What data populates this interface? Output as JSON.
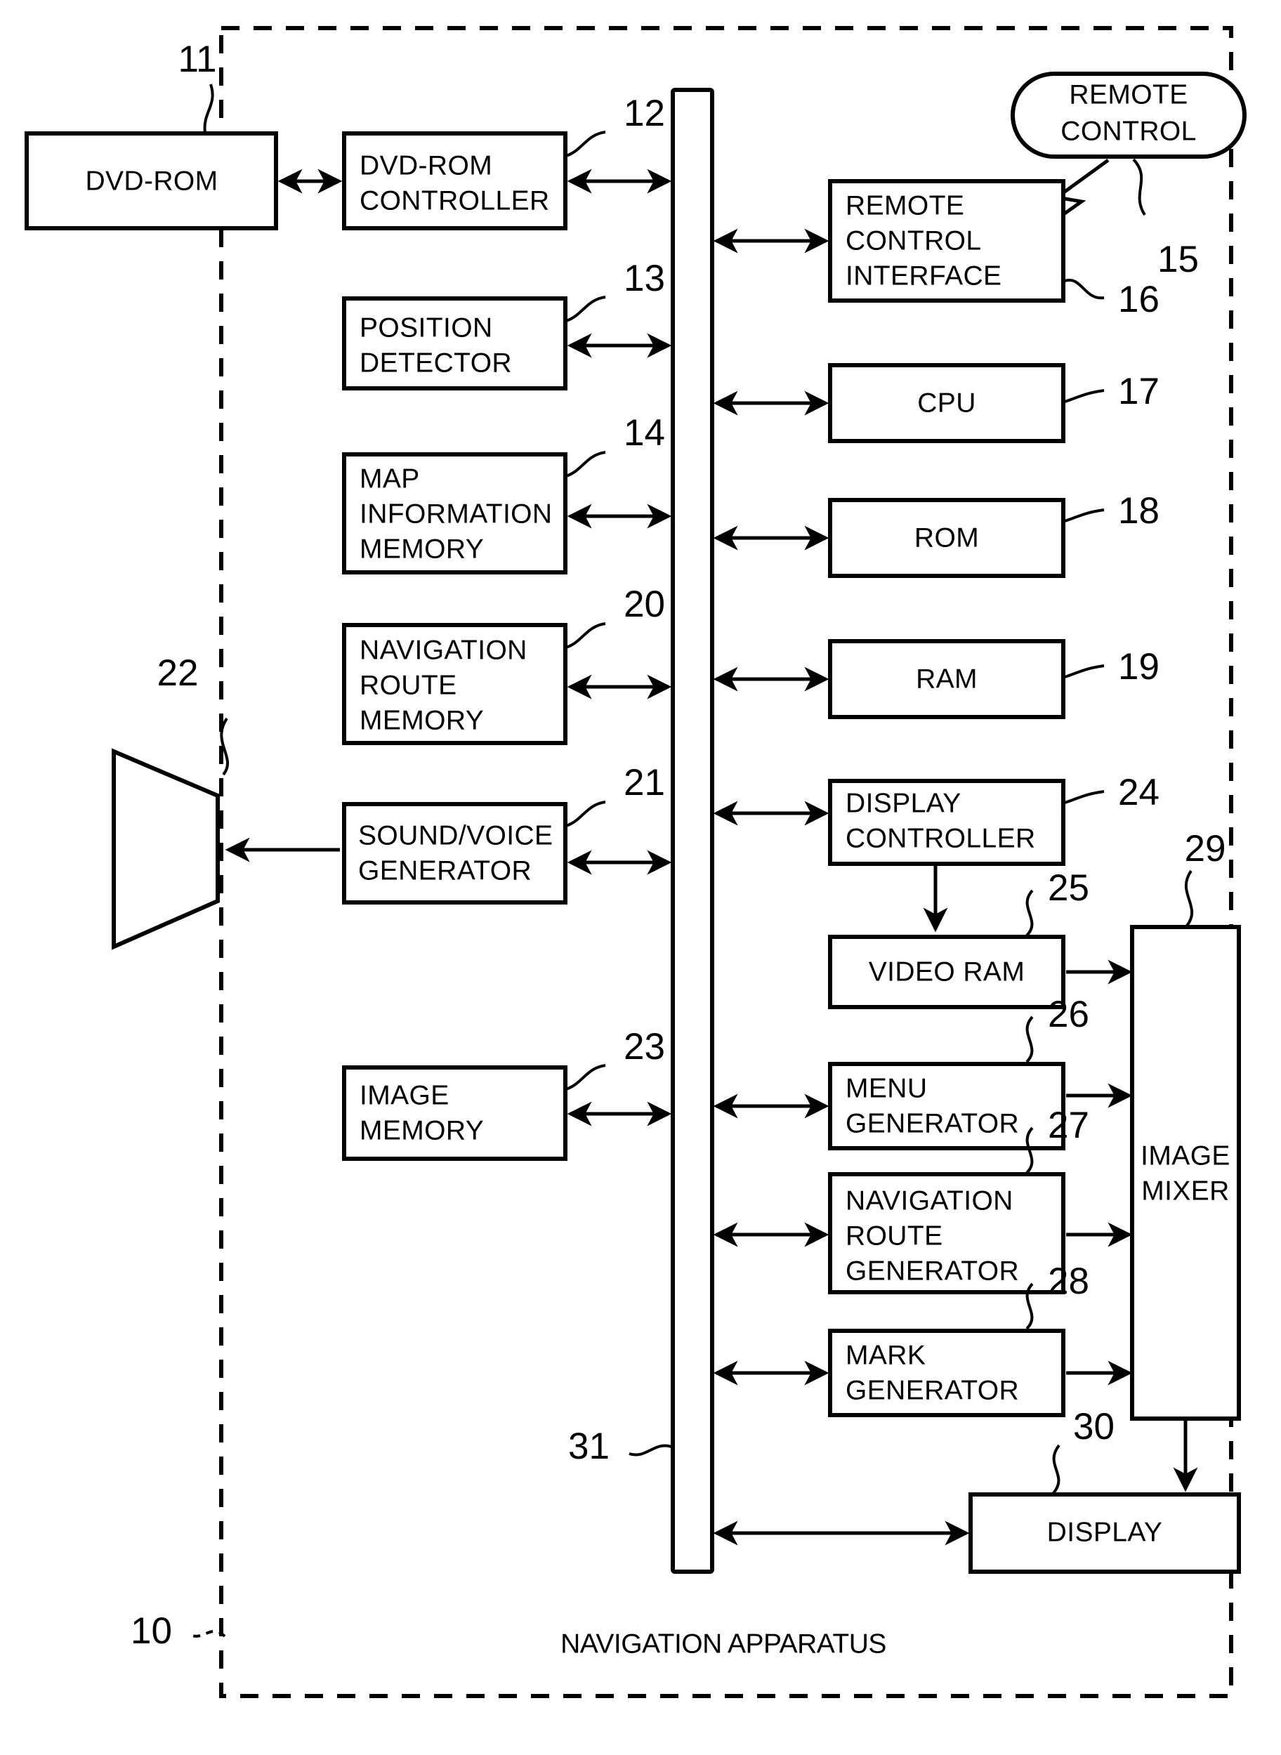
{
  "figure": {
    "title": "NAVIGATION APPARATUS",
    "outer_ref": "10"
  },
  "blocks": {
    "dvd_rom": {
      "label": "DVD-ROM",
      "ref": "11"
    },
    "dvd_rom_controller": {
      "line1": "DVD-ROM",
      "line2": "CONTROLLER",
      "ref": "12"
    },
    "position_detector": {
      "line1": "POSITION",
      "line2": "DETECTOR",
      "ref": "13"
    },
    "map_information_memory": {
      "line1": "MAP",
      "line2": "INFORMATION",
      "line3": "MEMORY",
      "ref": "14"
    },
    "navigation_route_memory": {
      "line1": "NAVIGATION",
      "line2": "ROUTE",
      "line3": "MEMORY",
      "ref": "20"
    },
    "sound_voice_generator": {
      "line1": "SOUND/VOICE",
      "line2": "GENERATOR",
      "ref": "21"
    },
    "speaker": {
      "ref": "22"
    },
    "image_memory": {
      "line1": "IMAGE",
      "line2": "MEMORY",
      "ref": "23"
    },
    "remote_control": {
      "line1": "REMOTE",
      "line2": "CONTROL",
      "ref": "15"
    },
    "remote_control_interface": {
      "line1": "REMOTE",
      "line2": "CONTROL",
      "line3": "INTERFACE",
      "ref": "16"
    },
    "cpu": {
      "label": "CPU",
      "ref": "17"
    },
    "rom": {
      "label": "ROM",
      "ref": "18"
    },
    "ram": {
      "label": "RAM",
      "ref": "19"
    },
    "display_controller": {
      "line1": "DISPLAY",
      "line2": "CONTROLLER",
      "ref": "24"
    },
    "video_ram": {
      "label": "VIDEO RAM",
      "ref": "25"
    },
    "menu_generator": {
      "line1": "MENU",
      "line2": "GENERATOR",
      "ref": "26"
    },
    "navigation_route_generator": {
      "line1": "NAVIGATION",
      "line2": "ROUTE",
      "line3": "GENERATOR",
      "ref": "27"
    },
    "mark_generator": {
      "line1": "MARK",
      "line2": "GENERATOR",
      "ref": "28"
    },
    "image_mixer": {
      "line1": "IMAGE",
      "line2": "MIXER",
      "ref": "29"
    },
    "display": {
      "label": "DISPLAY",
      "ref": "30"
    },
    "bus": {
      "ref": "31"
    }
  },
  "colors": {
    "ink": "#000000",
    "paper": "#ffffff"
  }
}
